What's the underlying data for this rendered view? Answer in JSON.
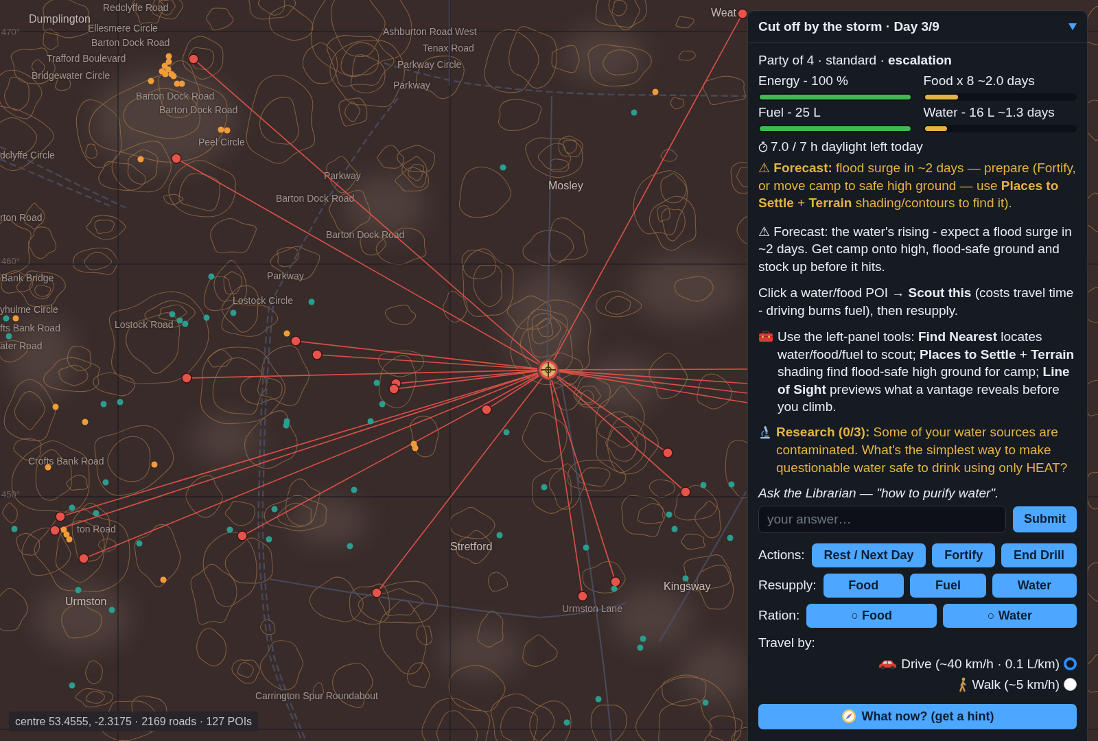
{
  "map": {
    "labels": [
      {
        "text": "Redclyffe Road",
        "kind": "road"
      },
      {
        "text": "Dumplington",
        "kind": "town"
      },
      {
        "text": "Weat",
        "kind": "town"
      },
      {
        "text": "470°",
        "kind": "grid"
      },
      {
        "text": "Ellesmere Circle",
        "kind": "road"
      },
      {
        "text": "Ashburton Road West",
        "kind": "road"
      },
      {
        "text": "Barton Dock Road",
        "kind": "road"
      },
      {
        "text": "Tenax Road",
        "kind": "road"
      },
      {
        "text": "Trafford Boulevard",
        "kind": "road"
      },
      {
        "text": "Parkway Circle",
        "kind": "road"
      },
      {
        "text": "Bridgewater Circle",
        "kind": "road"
      },
      {
        "text": "Parkway",
        "kind": "road"
      },
      {
        "text": "Barton Dock Road",
        "kind": "road"
      },
      {
        "text": "Barton Dock Road",
        "kind": "road"
      },
      {
        "text": "Peel Circle",
        "kind": "road"
      },
      {
        "text": "dclyffe Circle",
        "kind": "road"
      },
      {
        "text": "Parkway",
        "kind": "road"
      },
      {
        "text": "Mosley",
        "kind": "town"
      },
      {
        "text": "Barton Dock Road",
        "kind": "road"
      },
      {
        "text": "rton Road",
        "kind": "road"
      },
      {
        "text": "Barton Dock Road",
        "kind": "road"
      },
      {
        "text": "460°",
        "kind": "grid"
      },
      {
        "text": "Bank Bridge",
        "kind": "road"
      },
      {
        "text": "Parkway",
        "kind": "road"
      },
      {
        "text": "Lostock Circle",
        "kind": "road"
      },
      {
        "text": "yhulme Circle",
        "kind": "road"
      },
      {
        "text": "fts Bank Road",
        "kind": "road"
      },
      {
        "text": "Lostock Road",
        "kind": "road"
      },
      {
        "text": "ater Road",
        "kind": "road"
      },
      {
        "text": "Crofts Bank Road",
        "kind": "road"
      },
      {
        "text": "450°",
        "kind": "grid"
      },
      {
        "text": "ton Road",
        "kind": "road"
      },
      {
        "text": "Stretford",
        "kind": "town"
      },
      {
        "text": "Kingsway",
        "kind": "town"
      },
      {
        "text": "Urmston",
        "kind": "town"
      },
      {
        "text": "Urmston Lane",
        "kind": "road"
      },
      {
        "text": "Carrington Spur Roundabout",
        "kind": "road"
      }
    ],
    "pois": [
      {
        "kind": "target",
        "color": "#e5534b"
      },
      {
        "kind": "target",
        "color": "#e5534b"
      },
      {
        "kind": "target",
        "color": "#e5534b"
      },
      {
        "kind": "target",
        "color": "#e5534b"
      },
      {
        "kind": "target",
        "color": "#e5534b"
      },
      {
        "kind": "target",
        "color": "#e5534b"
      },
      {
        "kind": "target",
        "color": "#e5534b"
      },
      {
        "kind": "target",
        "color": "#e5534b"
      },
      {
        "kind": "target",
        "color": "#e5534b"
      },
      {
        "kind": "target",
        "color": "#e5534b"
      },
      {
        "kind": "target",
        "color": "#e5534b"
      },
      {
        "kind": "target",
        "color": "#e5534b"
      },
      {
        "kind": "target",
        "color": "#e5534b"
      },
      {
        "kind": "target",
        "color": "#e5534b"
      },
      {
        "kind": "target",
        "color": "#e5534b"
      },
      {
        "kind": "target",
        "color": "#e5534b"
      },
      {
        "kind": "target",
        "color": "#e5534b"
      },
      {
        "kind": "target",
        "color": "#e5534b"
      },
      {
        "kind": "offscreen"
      },
      {
        "kind": "offscreen"
      },
      {
        "kind": "offscreen"
      },
      {
        "kind": "offscreen"
      },
      {
        "kind": "dot",
        "color": "#f29c38"
      },
      {
        "kind": "dot",
        "color": "#f29c38"
      },
      {
        "kind": "dot",
        "color": "#f29c38"
      },
      {
        "kind": "dot",
        "color": "#f29c38"
      },
      {
        "kind": "dot",
        "color": "#f29c38"
      },
      {
        "kind": "dot",
        "color": "#f29c38"
      },
      {
        "kind": "dot",
        "color": "#f29c38"
      },
      {
        "kind": "dot",
        "color": "#f29c38"
      },
      {
        "kind": "dot",
        "color": "#f29c38"
      },
      {
        "kind": "dot",
        "color": "#f29c38"
      },
      {
        "kind": "dot",
        "color": "#f29c38"
      },
      {
        "kind": "dot",
        "color": "#f29c38"
      },
      {
        "kind": "dot",
        "color": "#f29c38"
      },
      {
        "kind": "dot",
        "color": "#f29c38"
      },
      {
        "kind": "dot",
        "color": "#f29c38"
      },
      {
        "kind": "dot",
        "color": "#f29c38"
      },
      {
        "kind": "dot",
        "color": "#f29c38"
      },
      {
        "kind": "dot",
        "color": "#f29c38"
      },
      {
        "kind": "dot",
        "color": "#f29c38"
      },
      {
        "kind": "dot",
        "color": "#f29c38"
      },
      {
        "kind": "dot",
        "color": "#f29c38"
      },
      {
        "kind": "dot",
        "color": "#f29c38"
      },
      {
        "kind": "dot",
        "color": "#f29c38"
      },
      {
        "kind": "dot",
        "color": "#f29c38"
      },
      {
        "kind": "dot",
        "color": "#f29c38"
      },
      {
        "kind": "dot",
        "color": "#f29c38"
      },
      {
        "kind": "dot",
        "color": "#f29c38"
      },
      {
        "kind": "dot",
        "color": "#2a9d8f"
      },
      {
        "kind": "dot",
        "color": "#2a9d8f"
      },
      {
        "kind": "dot",
        "color": "#2a9d8f"
      },
      {
        "kind": "dot",
        "color": "#2a9d8f"
      },
      {
        "kind": "dot",
        "color": "#2a9d8f"
      },
      {
        "kind": "dot",
        "color": "#2a9d8f"
      },
      {
        "kind": "dot",
        "color": "#2a9d8f"
      },
      {
        "kind": "dot",
        "color": "#2a9d8f"
      },
      {
        "kind": "dot",
        "color": "#2a9d8f"
      },
      {
        "kind": "dot",
        "color": "#2a9d8f"
      },
      {
        "kind": "dot",
        "color": "#2a9d8f"
      },
      {
        "kind": "dot",
        "color": "#2a9d8f"
      },
      {
        "kind": "dot",
        "color": "#2a9d8f"
      },
      {
        "kind": "dot",
        "color": "#2a9d8f"
      },
      {
        "kind": "dot",
        "color": "#2a9d8f"
      },
      {
        "kind": "dot",
        "color": "#2a9d8f"
      },
      {
        "kind": "dot",
        "color": "#2a9d8f"
      },
      {
        "kind": "dot",
        "color": "#2a9d8f"
      },
      {
        "kind": "dot",
        "color": "#2a9d8f"
      },
      {
        "kind": "dot",
        "color": "#2a9d8f"
      },
      {
        "kind": "dot",
        "color": "#2a9d8f"
      },
      {
        "kind": "dot",
        "color": "#2a9d8f"
      },
      {
        "kind": "dot",
        "color": "#2a9d8f"
      },
      {
        "kind": "dot",
        "color": "#2a9d8f"
      },
      {
        "kind": "dot",
        "color": "#2a9d8f"
      },
      {
        "kind": "dot",
        "color": "#2a9d8f"
      },
      {
        "kind": "dot",
        "color": "#2a9d8f"
      },
      {
        "kind": "dot",
        "color": "#2a9d8f"
      },
      {
        "kind": "dot",
        "color": "#2a9d8f"
      },
      {
        "kind": "dot",
        "color": "#2a9d8f"
      },
      {
        "kind": "dot",
        "color": "#2a9d8f"
      },
      {
        "kind": "dot",
        "color": "#2a9d8f"
      },
      {
        "kind": "dot",
        "color": "#2a9d8f"
      },
      {
        "kind": "dot",
        "color": "#2a9d8f"
      },
      {
        "kind": "dot",
        "color": "#2a9d8f"
      },
      {
        "kind": "dot",
        "color": "#2a9d8f"
      },
      {
        "kind": "dot",
        "color": "#2a9d8f"
      },
      {
        "kind": "dot",
        "color": "#2a9d8f"
      },
      {
        "kind": "dot",
        "color": "#2a9d8f"
      },
      {
        "kind": "dot",
        "color": "#2a9d8f"
      },
      {
        "kind": "dot",
        "color": "#2a9d8f"
      },
      {
        "kind": "dot",
        "color": "#2a9d8f"
      },
      {
        "kind": "dot",
        "color": "#2a9d8f"
      },
      {
        "kind": "dot",
        "color": "#2a9d8f"
      },
      {
        "kind": "dot",
        "color": "#2a9d8f"
      },
      {
        "kind": "dot",
        "color": "#2a9d8f"
      },
      {
        "kind": "dot",
        "color": "#2a9d8f"
      }
    ],
    "status": "centre 53.4555, -2.3175 · 2169 roads · 127 POIs"
  },
  "panel": {
    "title": "Cut off by the storm · Day 3/9",
    "expanded": true,
    "party": "Party of 4 · standard · **escalation**",
    "stats": [
      {
        "label": "Energy - 100 %",
        "level": 1,
        "color": "#3fb950"
      },
      {
        "label": "Food x 8 ~2.0 days",
        "level": 0.22,
        "color": "#e3b341"
      },
      {
        "label": "Fuel - 25 L",
        "level": 1,
        "color": "#3fb950"
      },
      {
        "label": "Water - 16 L ~1.3 days",
        "level": 0.15,
        "color": "#e3b341"
      }
    ],
    "daylight": "7.0 / 7 h daylight left today",
    "messages": [
      {
        "kind": "alert",
        "text": "⚠ **Forecast:** flood surge in ~2 days — prepare (Fortify, or move camp to safe high ground — use **Places to Settle** + **Terrain** shading/contours to find it)."
      },
      {
        "kind": "info",
        "text": "⚠ Forecast: the water's rising - expect a flood surge in ~2 days. Get camp onto high, flood-safe ground and stock up before it hits."
      },
      {
        "kind": "info",
        "text": "Click a water/food POI → **Scout this** (costs travel time - driving burns fuel), then resupply."
      },
      {
        "kind": "tip",
        "text": "Use the left-panel tools: **Find Nearest** locates water/food/fuel to scout; **Places to Settle** + **Terrain** shading find flood-safe high ground for camp; **Line of Sight** previews what a vantage reveals before you climb."
      },
      {
        "kind": "research",
        "text": "**Research (0/3):** Some of your water sources are contaminated. What's the simplest way to make questionable water safe to drink using only HEAT?"
      }
    ],
    "prompt": "Ask the Librarian — \"how to purify water\".",
    "answer": {
      "placeholder": "your answer…"
    },
    "submit": "Submit",
    "rows": [
      {
        "kind": "actions",
        "label": "Actions:",
        "buttons": [
          "Rest / Next Day",
          "Fortify",
          "End Drill"
        ]
      },
      {
        "kind": "resupply",
        "label": "Resupply:",
        "buttons": [
          "Food",
          "Fuel",
          "Water"
        ]
      },
      {
        "kind": "ration",
        "label": "Ration:",
        "buttons": [
          "○ Food",
          "○ Water"
        ]
      }
    ],
    "travel": {
      "label": "Travel by:",
      "options": [
        {
          "kind": "drive",
          "label": "Drive (~40 km/h · 0.1 L/km)",
          "selected": true
        },
        {
          "kind": "walk",
          "label": "Walk (~5 km/h)",
          "selected": false
        }
      ]
    },
    "hint": "What now? (get a hint)"
  }
}
